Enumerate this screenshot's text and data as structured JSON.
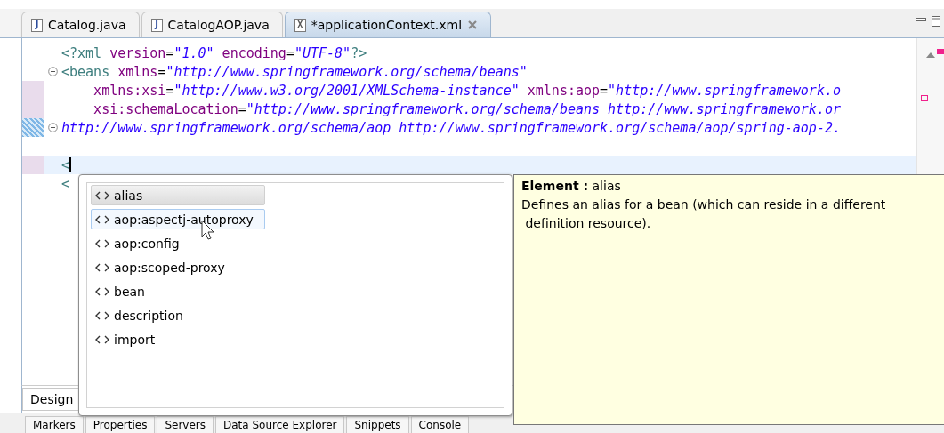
{
  "editor_tabs": [
    {
      "label": "Catalog.java",
      "kind": "java",
      "icon_text": "J",
      "selected": false,
      "closable": false
    },
    {
      "label": "CatalogAOP.java",
      "kind": "java",
      "icon_text": "J",
      "selected": false,
      "closable": false
    },
    {
      "label": "*applicationContext.xml",
      "kind": "xml",
      "icon_text": "X",
      "selected": true,
      "closable": true
    }
  ],
  "code_lines": [
    {
      "kind": "plain",
      "foldable": false,
      "current": false,
      "tokens": [
        {
          "kind": "tag",
          "text": "<?xml "
        },
        {
          "kind": "attr",
          "text": "version"
        },
        {
          "kind": "eq",
          "text": "="
        },
        {
          "kind": "value",
          "text": "\"1.0\""
        },
        {
          "kind": "attr",
          "text": " encoding"
        },
        {
          "kind": "eq",
          "text": "="
        },
        {
          "kind": "value",
          "text": "\"UTF-8\""
        },
        {
          "kind": "tag",
          "text": "?>"
        }
      ]
    },
    {
      "kind": "plain",
      "foldable": true,
      "current": false,
      "tokens": [
        {
          "kind": "tag",
          "text": "<beans "
        },
        {
          "kind": "attr",
          "text": "xmlns"
        },
        {
          "kind": "eq",
          "text": "="
        },
        {
          "kind": "value",
          "text": "\"http://www.springframework.org/schema/beans\""
        }
      ]
    },
    {
      "kind": "continuation",
      "foldable": false,
      "current": false,
      "tokens": [
        {
          "kind": "attr",
          "text": "xmlns:xsi"
        },
        {
          "kind": "eq",
          "text": "="
        },
        {
          "kind": "value",
          "text": "\"http://www.w3.org/2001/XMLSchema-instance\""
        },
        {
          "kind": "attr",
          "text": " xmlns:aop"
        },
        {
          "kind": "eq",
          "text": "="
        },
        {
          "kind": "value",
          "text": "\"http://www.springframework.o"
        }
      ]
    },
    {
      "kind": "continuation",
      "foldable": false,
      "current": false,
      "tokens": [
        {
          "kind": "attr",
          "text": "xsi:schemaLocation"
        },
        {
          "kind": "eq",
          "text": "="
        },
        {
          "kind": "value",
          "text": "\"http://www.springframework.org/schema/beans http://www.springframework.or"
        }
      ]
    },
    {
      "kind": "plain",
      "foldable": true,
      "current": false,
      "tokens": [
        {
          "kind": "value",
          "text": "http://www.springframework.org/schema/aop http://www.springframework.org/schema/aop/spring-aop-2."
        }
      ]
    },
    {
      "kind": "plain",
      "current": false
    },
    {
      "kind": "plain",
      "foldable": false,
      "current": true,
      "tokens": [
        {
          "kind": "tag",
          "text": "<"
        }
      ]
    },
    {
      "kind": "plain",
      "foldable": false,
      "current": false,
      "tokens": [
        {
          "kind": "tag",
          "text": "<"
        }
      ]
    }
  ],
  "design_tab": {
    "label": "Design"
  },
  "completion": {
    "items": [
      {
        "label": "alias",
        "selected": true,
        "hovered": false
      },
      {
        "label": "aop:aspectj-autoproxy",
        "selected": false,
        "hovered": true
      },
      {
        "label": "aop:config",
        "selected": false,
        "hovered": false
      },
      {
        "label": "aop:scoped-proxy",
        "selected": false,
        "hovered": false
      },
      {
        "label": "bean",
        "selected": false,
        "hovered": false
      },
      {
        "label": "description",
        "selected": false,
        "hovered": false
      },
      {
        "label": "import",
        "selected": false,
        "hovered": false
      }
    ]
  },
  "info": {
    "heading": "**Element :** alias",
    "description": "Defines an alias for a bean (which can reside in a different",
    "description_cont": "definition resource)."
  },
  "bottom_tabs": [
    {
      "label": "Markers"
    },
    {
      "label": "Properties"
    },
    {
      "label": "Servers"
    },
    {
      "label": "Data Source Explorer"
    },
    {
      "label": "Snippets"
    },
    {
      "label": "Console"
    }
  ]
}
